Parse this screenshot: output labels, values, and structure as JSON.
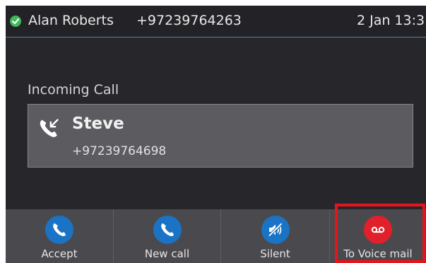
{
  "status_bar": {
    "presence_icon": "check-circle-icon",
    "presence_color": "#3fb95a",
    "user_name": "Alan Roberts",
    "user_number": "+97239764263",
    "datetime": "2 Jan 13:3"
  },
  "call": {
    "label": "Incoming Call",
    "icon": "incoming-call-icon",
    "caller_name": "Steve",
    "caller_number": "+97239764698"
  },
  "softkeys": [
    {
      "label": "Accept",
      "icon": "phone-icon",
      "color": "#1a73c4"
    },
    {
      "label": "New call",
      "icon": "phone-icon",
      "color": "#1a73c4"
    },
    {
      "label": "Silent",
      "icon": "speaker-mute-icon",
      "color": "#1a73c4"
    },
    {
      "label": "To Voice mail",
      "icon": "voicemail-icon",
      "color": "#e0202a"
    }
  ],
  "highlight_color": "#e8141c"
}
